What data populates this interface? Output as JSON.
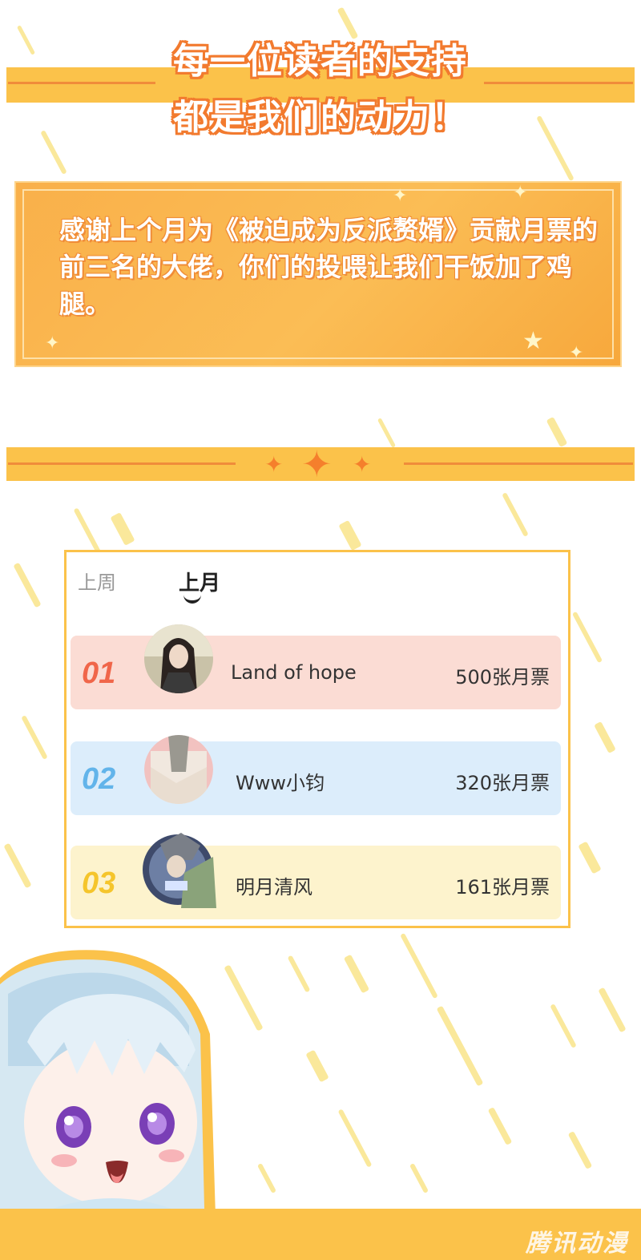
{
  "header": {
    "line1": "每一位读者的支持",
    "line2": "都是我们的动力！"
  },
  "thanks": {
    "text": "感谢上个月为《被迫成为反派赘婿》贡献月票的前三名的大佬，你们的投喂让我们干饭加了鸡腿。"
  },
  "ranking": {
    "tabs": [
      "上周",
      "上月"
    ],
    "active_tab": "上月",
    "rows": [
      {
        "rank": "01",
        "name": "Land of hope",
        "votes": "500张月票",
        "num_color": "#f0664a",
        "bg": "#fbdcd4"
      },
      {
        "rank": "02",
        "name": "Www小钧",
        "votes": "320张月票",
        "num_color": "#62b4ea",
        "bg": "#dcedfb"
      },
      {
        "rank": "03",
        "name": "明月清风",
        "votes": "161张月票",
        "num_color": "#f5c52c",
        "bg": "#fdf3cd"
      }
    ]
  },
  "footer": {
    "watermark": "腾讯动漫"
  },
  "colors": {
    "accent_yellow": "#fbc24a",
    "accent_orange": "#f08c3a",
    "streak": "#f8e07a"
  }
}
